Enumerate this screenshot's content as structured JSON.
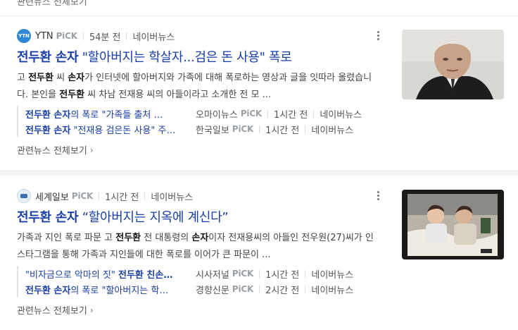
{
  "top_more": "관련뉴스 전체보기",
  "cards": [
    {
      "logo_text": "YTN",
      "source": "YTN",
      "pick": "PiCK",
      "time": "54분 전",
      "portal": "네이버뉴스",
      "title_bold": "전두환 손자",
      "title_rest": " \"할아버지는 학살자...검은 돈 사용\" 폭로",
      "desc": [
        "고 ",
        "전두환",
        " 씨 ",
        "손자",
        "가 인터넷에 할아버지와 가족에 대해 폭로하는 영상과 글을 잇따라 올렸습니다. 본인을 ",
        "전두환",
        " 씨 차남 전재용 씨의 아들이라고 소개한 전 모 ..."
      ],
      "related": [
        {
          "bold": "전두환 손자",
          "rest": "의 폭로 \"가족들 출처 …",
          "source": "오마이뉴스",
          "pick": "PiCK",
          "time": "1시간 전",
          "portal": "네이버뉴스"
        },
        {
          "bold": "전두환 손자",
          "rest": " \"전재용 검은돈 사용\" 주…",
          "source": "한국일보",
          "pick": "PiCK",
          "time": "1시간 전",
          "portal": "네이버뉴스"
        }
      ],
      "more": "관련뉴스 전체보기"
    },
    {
      "logo_text": "",
      "source": "세계일보",
      "pick": "PiCK",
      "time": "1시간 전",
      "portal": "네이버뉴스",
      "title_bold": "전두환 손자",
      "title_rest": " “할아버지는 지옥에 계신다”",
      "desc": [
        "가족과 지인 폭로 파문 고 ",
        "전두환",
        " 전 대통령의 ",
        "손자",
        "이자 전재용씨의 아들인 전우원(27)씨가 인스타그램을 통해 가족과 지인들에 대한 폭로를 이어가 큰 파문이 ..."
      ],
      "related": [
        {
          "pre": "\"비자금으로 악마의 짓\" ",
          "bold": "전두환 친손…",
          "rest": "",
          "source": "시사저널",
          "pick": "PiCK",
          "time": "1시간 전",
          "portal": "네이버뉴스"
        },
        {
          "bold": "전두환 손자",
          "rest": "의 폭로 \"할아버지는 학…",
          "source": "경향신문",
          "pick": "PiCK",
          "time": "2시간 전",
          "portal": "네이버뉴스"
        }
      ],
      "more": "관련뉴스 전체보기"
    }
  ],
  "colors": {
    "link": "#1a3fa6",
    "pick": "#9aa0a6",
    "ytn_logo": "#2e88d6"
  },
  "icons": [
    "kebab-menu-icon",
    "chevron-right-icon"
  ]
}
